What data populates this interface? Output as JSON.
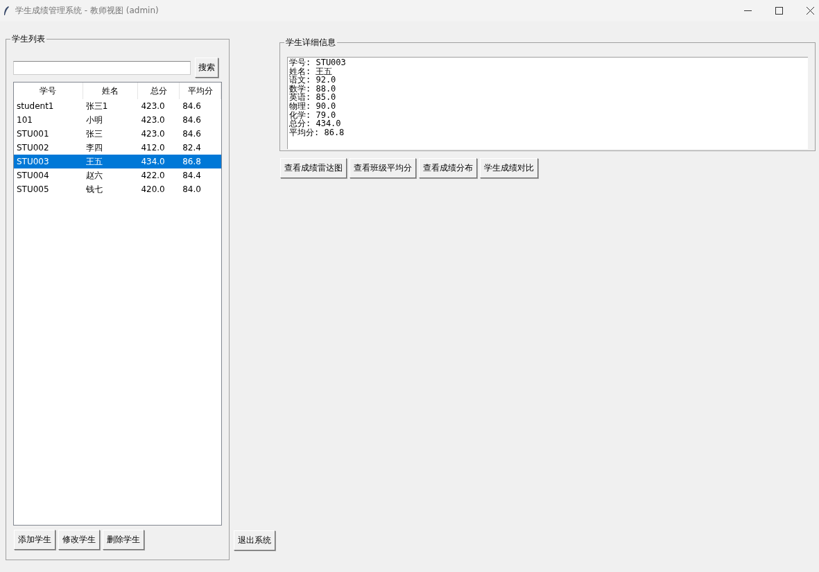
{
  "window": {
    "title": "学生成绩管理系统 - 教师视图 (admin)"
  },
  "student_list": {
    "title": "学生列表",
    "search": {
      "button": "搜索"
    },
    "columns": [
      "学号",
      "姓名",
      "总分",
      "平均分"
    ],
    "rows": [
      {
        "cells": [
          "student1",
          "张三1",
          "423.0",
          "84.6"
        ],
        "selected": false
      },
      {
        "cells": [
          "101",
          "小明",
          "423.0",
          "84.6"
        ],
        "selected": false
      },
      {
        "cells": [
          "STU001",
          "张三",
          "423.0",
          "84.6"
        ],
        "selected": false
      },
      {
        "cells": [
          "STU002",
          "李四",
          "412.0",
          "82.4"
        ],
        "selected": false
      },
      {
        "cells": [
          "STU003",
          "王五",
          "434.0",
          "86.8"
        ],
        "selected": true
      },
      {
        "cells": [
          "STU004",
          "赵六",
          "422.0",
          "84.4"
        ],
        "selected": false
      },
      {
        "cells": [
          "STU005",
          "钱七",
          "420.0",
          "84.0"
        ],
        "selected": false
      }
    ],
    "buttons": [
      "添加学生",
      "修改学生",
      "删除学生"
    ]
  },
  "exit_button": "退出系统",
  "details": {
    "title": "学生详细信息",
    "lines": [
      "学号: STU003",
      "姓名: 王五",
      "语文: 92.0",
      "数学: 88.0",
      "英语: 85.0",
      "物理: 90.0",
      "化学: 79.0",
      "总分: 434.0",
      "平均分: 86.8"
    ]
  },
  "chart_buttons": [
    "查看成绩雷达图",
    "查看班级平均分",
    "查看成绩分布",
    "学生成绩对比"
  ]
}
